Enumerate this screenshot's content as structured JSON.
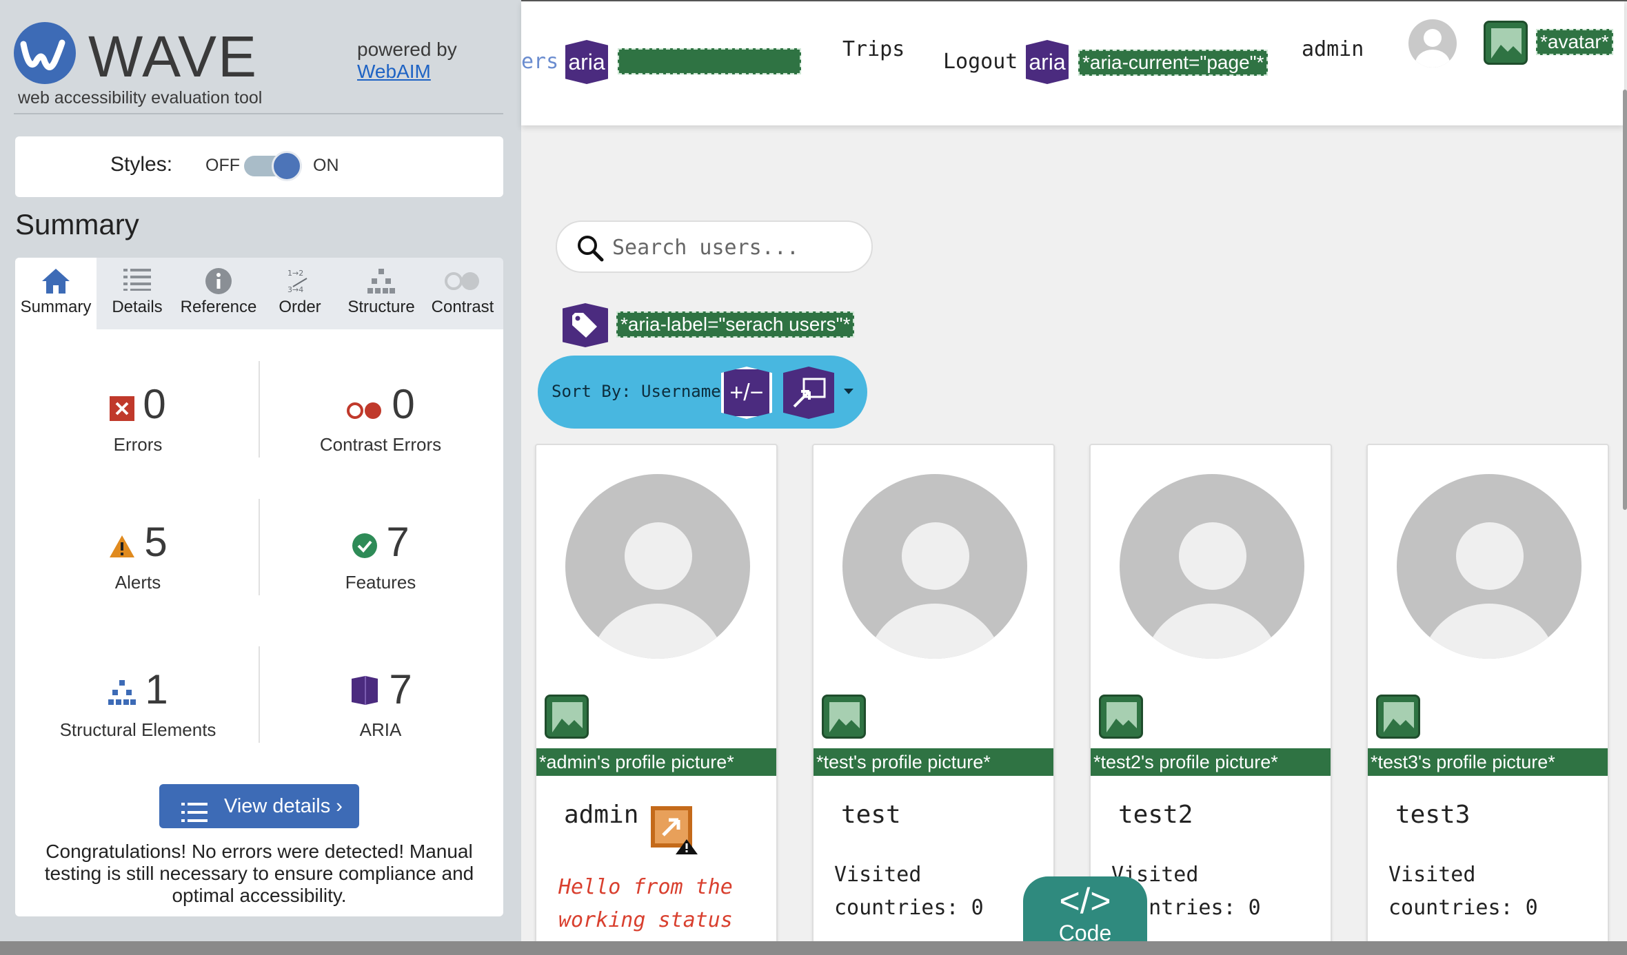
{
  "wave": {
    "title": "WAVE",
    "subtitle": "web accessibility evaluation tool",
    "powered_by": "powered by",
    "powered_link": "WebAIM",
    "styles_label": "Styles:",
    "styles_off": "OFF",
    "styles_on": "ON",
    "styles_enabled": true,
    "summary_heading": "Summary",
    "tabs": [
      {
        "label": "Summary",
        "icon": "home-icon",
        "active": true
      },
      {
        "label": "Details",
        "icon": "list-icon"
      },
      {
        "label": "Reference",
        "icon": "info-icon"
      },
      {
        "label": "Order",
        "icon": "order-icon"
      },
      {
        "label": "Structure",
        "icon": "structure-icon"
      },
      {
        "label": "Contrast",
        "icon": "contrast-icon"
      }
    ],
    "stats": {
      "errors": {
        "count": "0",
        "label": "Errors"
      },
      "contrast_errors": {
        "count": "0",
        "label": "Contrast Errors"
      },
      "alerts": {
        "count": "5",
        "label": "Alerts"
      },
      "features": {
        "count": "7",
        "label": "Features"
      },
      "structural": {
        "count": "1",
        "label": "Structural Elements"
      },
      "aria": {
        "count": "7",
        "label": "ARIA"
      }
    },
    "view_details": "View details ›",
    "congrats": "Congratulations! No errors were detected! Manual testing is still necessary to ensure compliance and optimal accessibility.",
    "colors": {
      "brand": "#3d6bb6",
      "error": "#c0392b",
      "alert": "#e08a1e",
      "feature": "#2e8b57",
      "aria": "#4b2b7f"
    }
  },
  "app": {
    "nav_partial": "ers",
    "aria_badge": "aria",
    "nav_trips": "Trips",
    "nav_logout": "Logout",
    "aria_current_label": "*aria-current=\"page\"*",
    "nav_admin": "admin",
    "avatar_label": "*avatar*",
    "search_placeholder": "Search users...",
    "search_aria_label": "*aria-label=\"serach users\"*",
    "sort_label": "Sort By: Username",
    "sort_pm": "+/−",
    "users": [
      {
        "alt": "*admin's profile picture*",
        "name": "admin",
        "status": "Hello from the working status"
      },
      {
        "alt": "*test's profile picture*",
        "name": "test",
        "visited": "Visited countries: 0"
      },
      {
        "alt": "*test2's profile picture*",
        "name": "test2",
        "visited": "Visited countries: 0"
      },
      {
        "alt": "*test3's profile picture*",
        "name": "test3",
        "visited": "Visited countries: 0"
      }
    ],
    "code_symbol": "</>",
    "code_label": "Code"
  }
}
